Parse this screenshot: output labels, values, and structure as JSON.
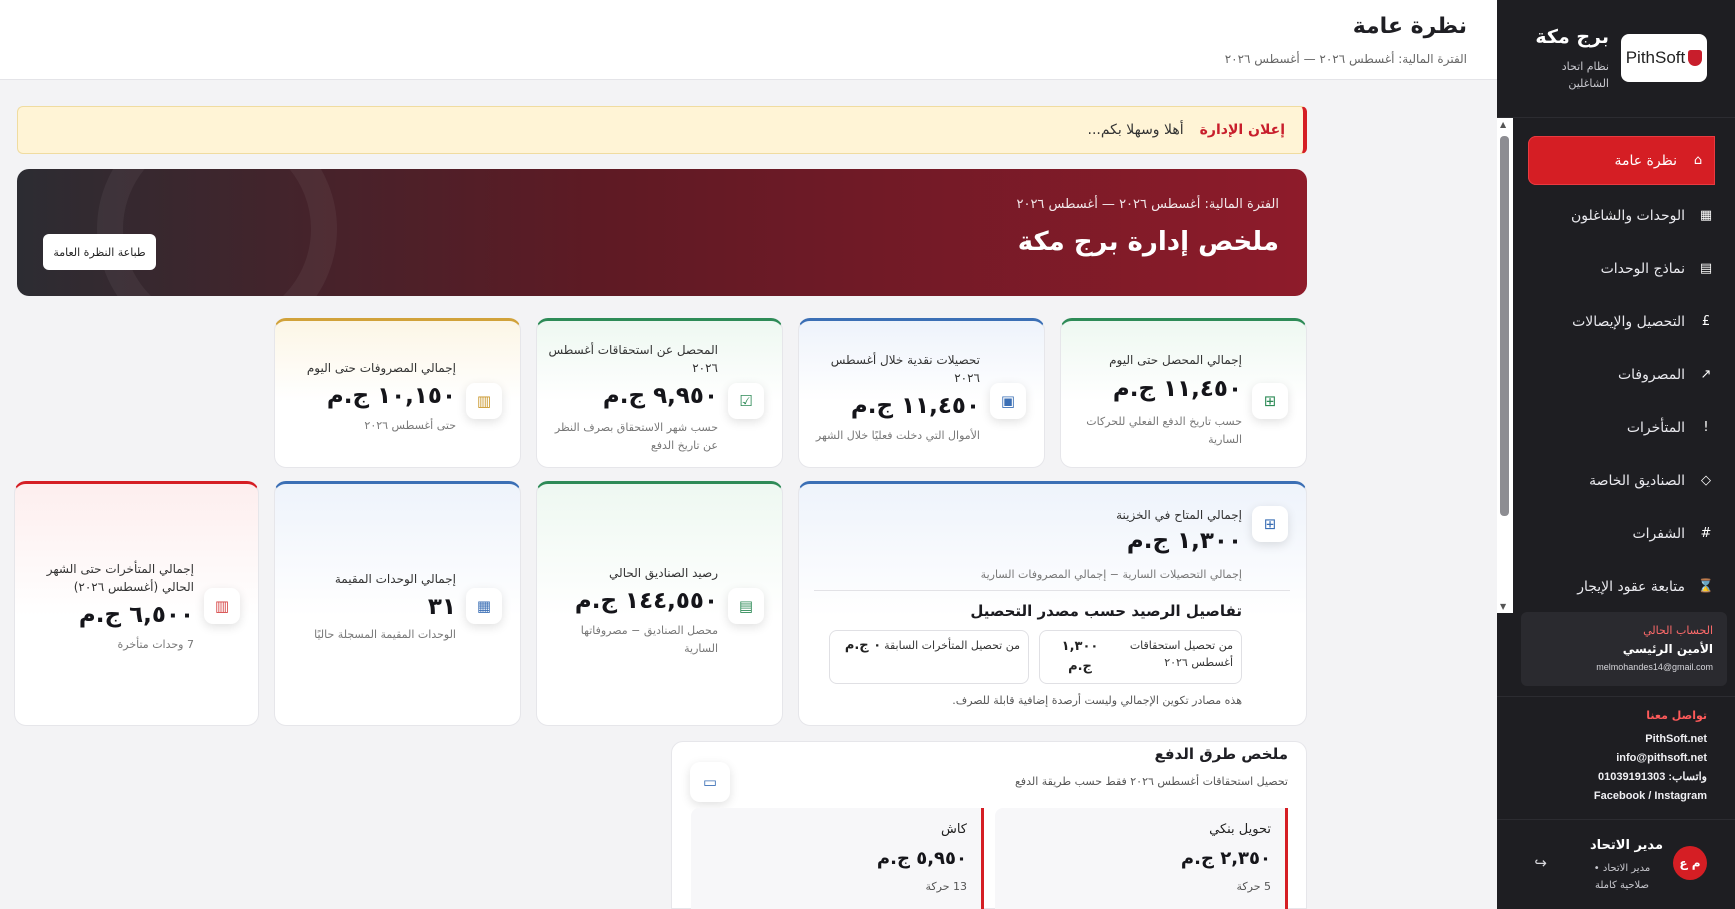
{
  "sidebar": {
    "logo_text": "PithSoft",
    "brand_title": "برج مكة",
    "brand_subtitle": "نظام اتحاد الشاغلين",
    "nav": [
      {
        "label": "نظرة عامة",
        "icon": "⌂"
      },
      {
        "label": "الوحدات والشاغلون",
        "icon": "▦"
      },
      {
        "label": "نماذج الوحدات",
        "icon": "▤"
      },
      {
        "label": "التحصيل والإيصالات",
        "icon": "£"
      },
      {
        "label": "المصروفات",
        "icon": "↗"
      },
      {
        "label": "المتأخرات",
        "icon": "!"
      },
      {
        "label": "الصناديق الخاصة",
        "icon": "◇"
      },
      {
        "label": "الشفرات",
        "icon": "#"
      },
      {
        "label": "متابعة عقود الإيجار",
        "icon": "⌛"
      }
    ],
    "account": {
      "label": "الحساب الحالي",
      "name": "الأمين الرئيسي",
      "email": "melmohandes14@gmail.com"
    },
    "contact": {
      "label": "تواصل معنا",
      "website": "PithSoft.net",
      "email": "info@pithsoft.net",
      "whatsapp": "واتساب: 01039191303",
      "social": "Facebook / Instagram"
    },
    "user": {
      "initials": "م ع",
      "name": "مدير الاتحاد",
      "role": "مدير الاتحاد • صلاحية كاملة"
    }
  },
  "header": {
    "title": "نظرة عامة",
    "period": "الفترة المالية: أغسطس ٢٠٢٦ — أغسطس ٢٠٢٦"
  },
  "announcement": {
    "tag": "إعلان الإدارة",
    "message": "أهلا وسهلا بكم..."
  },
  "hero": {
    "period": "الفترة المالية: أغسطس ٢٠٢٦ — أغسطس ٢٠٢٦",
    "title": "ملخص إدارة برج مكة",
    "print_button": "طباعة النظرة العامة"
  },
  "cards": {
    "collected_to_date": {
      "label": "إجمالي المحصل حتى اليوم",
      "value": "١١,٤٥٠ ج.م",
      "sub": "حسب تاريخ الدفع الفعلي للحركات السارية"
    },
    "cash_in_month": {
      "label": "تحصيلات نقدية خلال أغسطس ٢٠٢٦",
      "value": "١١,٤٥٠ ج.م",
      "sub": "الأموال التي دخلت فعليًا خلال الشهر"
    },
    "collected_for_month": {
      "label": "المحصل عن استحقاقات أغسطس ٢٠٢٦",
      "value": "٩,٩٥٠ ج.م",
      "sub": "حسب شهر الاستحقاق بصرف النظر عن تاريخ الدفع"
    },
    "expenses_to_date": {
      "label": "إجمالي المصروفات حتى اليوم",
      "value": "١٠,١٥٠ ج.م",
      "sub": "حتى أغسطس ٢٠٢٦"
    },
    "treasury": {
      "label": "إجمالي المتاح في الخزينة",
      "value": "١,٣٠٠ ج.م",
      "sub": "إجمالي التحصيلات السارية − إجمالي المصروفات السارية",
      "breakdown_title": "تفاصيل الرصيد حسب مصدر التحصيل",
      "sources": [
        {
          "label": "من تحصيل استحقاقات أغسطس ٢٠٢٦",
          "value": "١,٣٠٠ ج.م"
        },
        {
          "label": "من تحصيل المتأخرات السابقة",
          "value": "٠ ج.م"
        }
      ],
      "note": "هذه مصادر تكوين الإجمالي وليست أرصدة إضافية قابلة للصرف."
    },
    "funds_balance": {
      "label": "رصيد الصناديق الحالي",
      "value": "١٤٤,٥٥٠ ج.م",
      "sub": "محصل الصناديق − مصروفاتها السارية"
    },
    "resident_units": {
      "label": "إجمالي الوحدات المقيمة",
      "value": "٣١",
      "sub": "الوحدات المقيمة المسجلة حاليًا"
    },
    "arrears": {
      "label": "إجمالي المتأخرات حتى الشهر الحالي (أغسطس ٢٠٢٦)",
      "value": "٦,٥٠٠ ج.م",
      "sub": "7 وحدات متأخرة"
    }
  },
  "payments": {
    "title": "ملخص طرق الدفع",
    "subtitle": "تحصيل استحقاقات أغسطس ٢٠٢٦ فقط حسب طريقة الدفع",
    "methods": [
      {
        "name": "تحويل بنكي",
        "value": "٢,٣٥٠ ج.م",
        "count": "5 حركة"
      },
      {
        "name": "كاش",
        "value": "٥,٩٥٠ ج.م",
        "count": "13 حركة"
      }
    ]
  }
}
